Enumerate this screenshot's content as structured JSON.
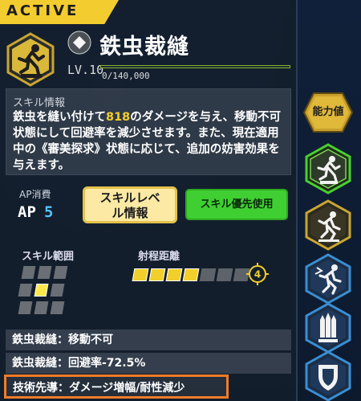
{
  "tab": {
    "label": "ACTIVE"
  },
  "skill": {
    "name": "鉄虫裁縫",
    "level": "LV.10",
    "xp_text": "0/140,000",
    "xp_fraction": 0
  },
  "info": {
    "title": "スキル情報",
    "desc_pre": "鉄虫を縫い付けて",
    "desc_num": "818",
    "desc_post": "のダメージを与え、移動不可状態にして回避率を減少させます。また、現在適用中の《審美探求》状態に応じて、追加の妨害効果を与えます。"
  },
  "ap": {
    "label": "AP消費",
    "key": "AP",
    "value": "5"
  },
  "buttons": {
    "level_info": "スキルレベル情報",
    "priority": "スキル優先使用"
  },
  "range": {
    "label": "スキル範囲",
    "active_cell": 4
  },
  "distance": {
    "label": "射程距離",
    "filled": 4,
    "total": 7,
    "value": "4"
  },
  "effects": [
    "鉄虫裁縫：移動不可",
    "鉄虫裁縫：回避率-72.5%",
    "技術先導：ダメージ増幅/耐性減少"
  ],
  "sidebar": {
    "stat_button": "能力値"
  },
  "colors": {
    "accent": "#f3cc2f",
    "highlight_border": "#f07c28",
    "ap_value": "#54c1ff",
    "green": "#3fcf32"
  }
}
